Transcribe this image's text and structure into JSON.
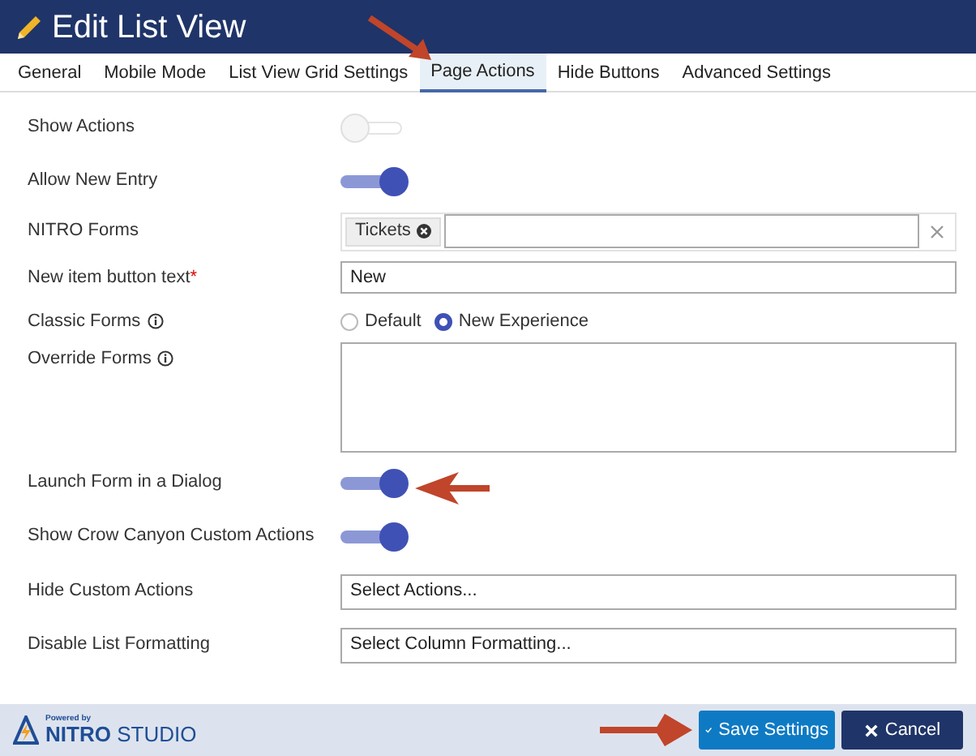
{
  "header": {
    "title": "Edit List View"
  },
  "tabs": [
    {
      "label": "General",
      "selected": false
    },
    {
      "label": "Mobile Mode",
      "selected": false
    },
    {
      "label": "List View Grid Settings",
      "selected": false
    },
    {
      "label": "Page Actions",
      "selected": true
    },
    {
      "label": "Hide Buttons",
      "selected": false
    },
    {
      "label": "Advanced Settings",
      "selected": false
    }
  ],
  "settings": [
    {
      "kind": "toggle",
      "label": "Show Actions",
      "on": false
    },
    {
      "kind": "toggle",
      "label": "Allow New Entry",
      "on": true
    },
    {
      "kind": "tags",
      "label": "NITRO Forms",
      "tags": [
        "Tickets"
      ]
    },
    {
      "kind": "text",
      "label": "New item button text",
      "required_mark": "*",
      "value": "New"
    },
    {
      "kind": "radio",
      "label": "Classic Forms",
      "info": true,
      "options": [
        {
          "label": "Default",
          "selected": false
        },
        {
          "label": "New Experience",
          "selected": true
        }
      ]
    },
    {
      "kind": "textarea",
      "label": "Override Forms",
      "info": true
    },
    {
      "kind": "toggle",
      "label": "Launch Form in a Dialog",
      "on": true
    },
    {
      "kind": "toggle",
      "label": "Show Crow Canyon Custom Actions",
      "on": true
    },
    {
      "kind": "select",
      "label": "Hide Custom Actions",
      "placeholder": "Select Actions..."
    },
    {
      "kind": "select",
      "label": "Disable List Formatting",
      "placeholder": "Select Column Formatting..."
    }
  ],
  "footer": {
    "powered_by": "Powered by",
    "brand": "NITRO",
    "brand_suffix": "STUDIO",
    "buttons": [
      {
        "kind": "primary",
        "label": "Save Settings"
      },
      {
        "kind": "cancel",
        "label": "Cancel"
      }
    ]
  }
}
